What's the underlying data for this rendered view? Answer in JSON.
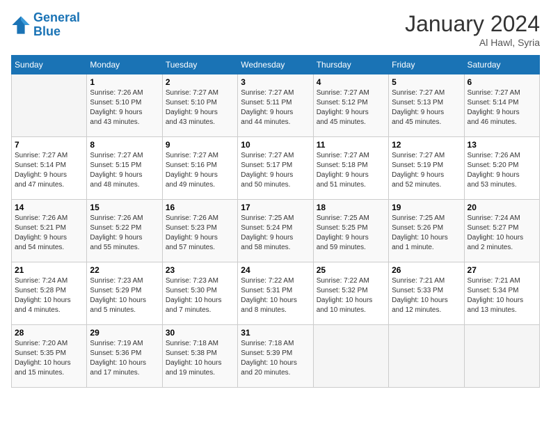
{
  "header": {
    "logo_line1": "General",
    "logo_line2": "Blue",
    "title": "January 2024",
    "subtitle": "Al Hawl, Syria"
  },
  "weekdays": [
    "Sunday",
    "Monday",
    "Tuesday",
    "Wednesday",
    "Thursday",
    "Friday",
    "Saturday"
  ],
  "weeks": [
    [
      {
        "day": "",
        "info": ""
      },
      {
        "day": "1",
        "info": "Sunrise: 7:26 AM\nSunset: 5:10 PM\nDaylight: 9 hours\nand 43 minutes."
      },
      {
        "day": "2",
        "info": "Sunrise: 7:27 AM\nSunset: 5:10 PM\nDaylight: 9 hours\nand 43 minutes."
      },
      {
        "day": "3",
        "info": "Sunrise: 7:27 AM\nSunset: 5:11 PM\nDaylight: 9 hours\nand 44 minutes."
      },
      {
        "day": "4",
        "info": "Sunrise: 7:27 AM\nSunset: 5:12 PM\nDaylight: 9 hours\nand 45 minutes."
      },
      {
        "day": "5",
        "info": "Sunrise: 7:27 AM\nSunset: 5:13 PM\nDaylight: 9 hours\nand 45 minutes."
      },
      {
        "day": "6",
        "info": "Sunrise: 7:27 AM\nSunset: 5:14 PM\nDaylight: 9 hours\nand 46 minutes."
      }
    ],
    [
      {
        "day": "7",
        "info": "Sunrise: 7:27 AM\nSunset: 5:14 PM\nDaylight: 9 hours\nand 47 minutes."
      },
      {
        "day": "8",
        "info": "Sunrise: 7:27 AM\nSunset: 5:15 PM\nDaylight: 9 hours\nand 48 minutes."
      },
      {
        "day": "9",
        "info": "Sunrise: 7:27 AM\nSunset: 5:16 PM\nDaylight: 9 hours\nand 49 minutes."
      },
      {
        "day": "10",
        "info": "Sunrise: 7:27 AM\nSunset: 5:17 PM\nDaylight: 9 hours\nand 50 minutes."
      },
      {
        "day": "11",
        "info": "Sunrise: 7:27 AM\nSunset: 5:18 PM\nDaylight: 9 hours\nand 51 minutes."
      },
      {
        "day": "12",
        "info": "Sunrise: 7:27 AM\nSunset: 5:19 PM\nDaylight: 9 hours\nand 52 minutes."
      },
      {
        "day": "13",
        "info": "Sunrise: 7:26 AM\nSunset: 5:20 PM\nDaylight: 9 hours\nand 53 minutes."
      }
    ],
    [
      {
        "day": "14",
        "info": "Sunrise: 7:26 AM\nSunset: 5:21 PM\nDaylight: 9 hours\nand 54 minutes."
      },
      {
        "day": "15",
        "info": "Sunrise: 7:26 AM\nSunset: 5:22 PM\nDaylight: 9 hours\nand 55 minutes."
      },
      {
        "day": "16",
        "info": "Sunrise: 7:26 AM\nSunset: 5:23 PM\nDaylight: 9 hours\nand 57 minutes."
      },
      {
        "day": "17",
        "info": "Sunrise: 7:25 AM\nSunset: 5:24 PM\nDaylight: 9 hours\nand 58 minutes."
      },
      {
        "day": "18",
        "info": "Sunrise: 7:25 AM\nSunset: 5:25 PM\nDaylight: 9 hours\nand 59 minutes."
      },
      {
        "day": "19",
        "info": "Sunrise: 7:25 AM\nSunset: 5:26 PM\nDaylight: 10 hours\nand 1 minute."
      },
      {
        "day": "20",
        "info": "Sunrise: 7:24 AM\nSunset: 5:27 PM\nDaylight: 10 hours\nand 2 minutes."
      }
    ],
    [
      {
        "day": "21",
        "info": "Sunrise: 7:24 AM\nSunset: 5:28 PM\nDaylight: 10 hours\nand 4 minutes."
      },
      {
        "day": "22",
        "info": "Sunrise: 7:23 AM\nSunset: 5:29 PM\nDaylight: 10 hours\nand 5 minutes."
      },
      {
        "day": "23",
        "info": "Sunrise: 7:23 AM\nSunset: 5:30 PM\nDaylight: 10 hours\nand 7 minutes."
      },
      {
        "day": "24",
        "info": "Sunrise: 7:22 AM\nSunset: 5:31 PM\nDaylight: 10 hours\nand 8 minutes."
      },
      {
        "day": "25",
        "info": "Sunrise: 7:22 AM\nSunset: 5:32 PM\nDaylight: 10 hours\nand 10 minutes."
      },
      {
        "day": "26",
        "info": "Sunrise: 7:21 AM\nSunset: 5:33 PM\nDaylight: 10 hours\nand 12 minutes."
      },
      {
        "day": "27",
        "info": "Sunrise: 7:21 AM\nSunset: 5:34 PM\nDaylight: 10 hours\nand 13 minutes."
      }
    ],
    [
      {
        "day": "28",
        "info": "Sunrise: 7:20 AM\nSunset: 5:35 PM\nDaylight: 10 hours\nand 15 minutes."
      },
      {
        "day": "29",
        "info": "Sunrise: 7:19 AM\nSunset: 5:36 PM\nDaylight: 10 hours\nand 17 minutes."
      },
      {
        "day": "30",
        "info": "Sunrise: 7:18 AM\nSunset: 5:38 PM\nDaylight: 10 hours\nand 19 minutes."
      },
      {
        "day": "31",
        "info": "Sunrise: 7:18 AM\nSunset: 5:39 PM\nDaylight: 10 hours\nand 20 minutes."
      },
      {
        "day": "",
        "info": ""
      },
      {
        "day": "",
        "info": ""
      },
      {
        "day": "",
        "info": ""
      }
    ]
  ]
}
